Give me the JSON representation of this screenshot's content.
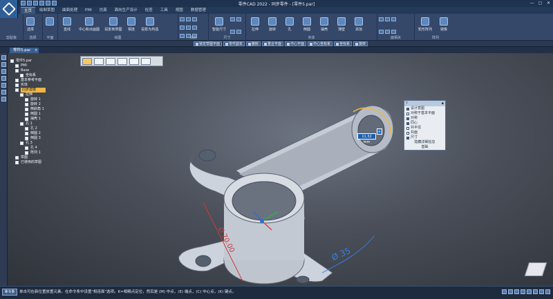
{
  "window": {
    "title": "零件CAD 2022 - 同步零件 - [零件5.par]",
    "controls": [
      "—",
      "▢",
      "✕"
    ]
  },
  "ribbon": {
    "tabs": [
      {
        "label": "主页",
        "active": true
      },
      {
        "label": "绘制草图"
      },
      {
        "label": "曲面处理"
      },
      {
        "label": "PMI"
      },
      {
        "label": "仿真"
      },
      {
        "label": "面向生产设计"
      },
      {
        "label": "检查"
      },
      {
        "label": "工具"
      },
      {
        "label": "视图"
      },
      {
        "label": "数据管理"
      }
    ],
    "groups": [
      {
        "label": "剪贴板",
        "tools": [
          "粘贴"
        ]
      },
      {
        "label": "选择",
        "tools": [
          "选择"
        ]
      },
      {
        "label": "平面",
        "tools": [
          "平面"
        ]
      },
      {
        "label": "绘图",
        "tools": [
          "直线",
          "中心和点画圆",
          "投影到草图",
          "相连",
          "投影为构造"
        ]
      },
      {
        "label": "相关",
        "tools": []
      },
      {
        "label": "尺寸",
        "tools": [
          "智能尺寸"
        ]
      },
      {
        "label": "实体",
        "tools": [
          "拉伸",
          "旋转",
          "孔",
          "倒圆",
          "抽壳",
          "薄壁",
          "添加"
        ]
      },
      {
        "label": "面相关",
        "tools": []
      },
      {
        "label": "阵列",
        "tools": [
          "矩形阵列",
          "镜像"
        ]
      }
    ]
  },
  "command_bar": {
    "items": [
      "锁定草图平面",
      "零件副本",
      "删除",
      "重合平面",
      "中心平面",
      "中心坐标系",
      "坐标系",
      "旋转"
    ]
  },
  "document": {
    "tab_label": "零件5.par",
    "close_glyph": "×"
  },
  "feature_tree": {
    "rows": [
      {
        "label": "零件5.par",
        "indent": 0
      },
      {
        "label": "PMI",
        "indent": 1
      },
      {
        "label": "Base",
        "indent": 1
      },
      {
        "label": "坐标系",
        "indent": 2
      },
      {
        "label": "基本参考平面",
        "indent": 1
      },
      {
        "label": "实体",
        "indent": 1
      },
      {
        "label": "同步建模",
        "indent": 1,
        "highlighted": true
      },
      {
        "label": "拉伸",
        "indent": 2
      },
      {
        "label": "旋转 1",
        "indent": 3
      },
      {
        "label": "旋转 2",
        "indent": 3
      },
      {
        "label": "倒斜角 1",
        "indent": 3
      },
      {
        "label": "倒圆 1",
        "indent": 3
      },
      {
        "label": "抽壳 1",
        "indent": 3
      },
      {
        "label": "孔 1",
        "indent": 2
      },
      {
        "label": "孔 2",
        "indent": 3
      },
      {
        "label": "倒圆 2",
        "indent": 3
      },
      {
        "label": "倒圆 3",
        "indent": 3
      },
      {
        "label": "孔 3",
        "indent": 2
      },
      {
        "label": "孔 4",
        "indent": 3
      },
      {
        "label": "阵列 1",
        "indent": 3
      },
      {
        "label": "草图",
        "indent": 1
      },
      {
        "label": "已使用的草图",
        "indent": 1
      }
    ]
  },
  "selection_filter": {
    "rows": [
      {
        "label": "设计意图",
        "checked": true
      },
      {
        "label": "对称于基本平面",
        "checked": false
      },
      {
        "label": "对称",
        "checked": true
      },
      {
        "label": "同心",
        "checked": true
      },
      {
        "label": "共半径",
        "checked": false
      },
      {
        "label": "共面",
        "checked": false
      },
      {
        "label": "尺寸",
        "checked": true
      }
    ],
    "footer": "基础",
    "footer2": "隐藏详细信息"
  },
  "dimensions": {
    "active_input": "11.32 mm",
    "lock_glyph": "+",
    "diameter_35": "Ø 35",
    "diameter_70": "Ø 70.00"
  },
  "status": {
    "badge": "命令条",
    "prompt": "单击可在新位置放置元素。在命令条中设置\"相连面\"选项。K=相精点定位，然后是 (M) 中点，(E) 端点，(C) 中心点，(K) 键点。"
  },
  "colors": {
    "highlight": "#f0b640",
    "dimension_blue": "#3a7fe0",
    "dimension_red": "#cf3a3a",
    "model_fill": "#cdd3dc"
  }
}
